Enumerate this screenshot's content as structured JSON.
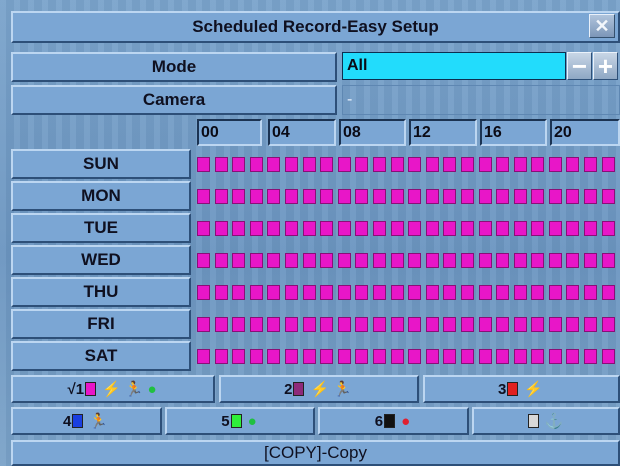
{
  "title": "Scheduled Record-Easy Setup",
  "close_icon": "close-x-icon",
  "mode": {
    "label": "Mode",
    "value": "All",
    "minus_label": "−",
    "plus_label": "+"
  },
  "camera": {
    "label": "Camera",
    "value": "-"
  },
  "hours": [
    "00",
    "04",
    "08",
    "12",
    "16",
    "20"
  ],
  "days": [
    "SUN",
    "MON",
    "TUE",
    "WED",
    "THU",
    "FRI",
    "SAT"
  ],
  "slot_color": "#e816c8",
  "legend": [
    {
      "num": "√1",
      "color": "#e816c8",
      "icons": [
        "alarm-icon",
        "motion-icon",
        "continuous-icon"
      ]
    },
    {
      "num": "2",
      "color": "#8e2a7a",
      "icons": [
        "alarm-icon",
        "motion-icon"
      ]
    },
    {
      "num": "3",
      "color": "#e02020",
      "icons": [
        "alarm-icon"
      ]
    },
    {
      "num": "4",
      "color": "#1a3fe0",
      "icons": [
        "motion-icon"
      ]
    },
    {
      "num": "5",
      "color": "#2ef03a",
      "icons": [
        "continuous-icon"
      ]
    },
    {
      "num": "6",
      "color": "#111111",
      "icons": [
        "record-icon"
      ]
    },
    {
      "num": "",
      "color": "#d8d8d8",
      "icons": [
        "none-icon"
      ]
    }
  ],
  "footer": "[COPY]-Copy"
}
